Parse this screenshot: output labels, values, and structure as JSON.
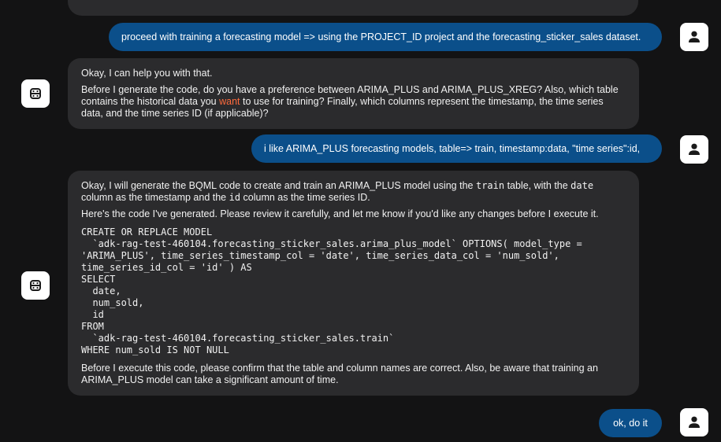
{
  "messages": {
    "user1": "proceed with training a forecasting model => using the PROJECT_ID project and the forecasting_sticker_sales dataset.",
    "bot1": {
      "line1": "Okay, I can help you with that.",
      "para_before": "Before I generate the code, do you have a preference between ARIMA_PLUS and ARIMA_PLUS_XREG? Also, which table contains the historical data you ",
      "para_highlight": "want",
      "para_after": " to use for training? Finally, which columns represent the timestamp, the time series data, and the time series ID (if applicable)?"
    },
    "user2": "i like ARIMA_PLUS forecasting models, table=> train, timestamp:data, \"time series\":id,",
    "bot2": {
      "p1_a": "Okay, I will generate the BQML code to create and train an ARIMA_PLUS model using the ",
      "p1_code1": "train",
      "p1_b": " table, with the ",
      "p1_code2": "date",
      "p1_c": " column as the timestamp and the ",
      "p1_code3": "id",
      "p1_d": " column as the time series ID.",
      "p2": "Here's the code I've generated. Please review it carefully, and let me know if you'd like any changes before I execute it.",
      "code": "CREATE OR REPLACE MODEL\n  `adk-rag-test-460104.forecasting_sticker_sales.arima_plus_model` OPTIONS( model_type =\n'ARIMA_PLUS', time_series_timestamp_col = 'date', time_series_data_col = 'num_sold',\ntime_series_id_col = 'id' ) AS\nSELECT\n  date,\n  num_sold,\n  id\nFROM\n  `adk-rag-test-460104.forecasting_sticker_sales.train`\nWHERE num_sold IS NOT NULL",
      "p3": "Before I execute this code, please confirm that the table and column names are correct. Also, be aware that training an ARIMA_PLUS model can take a significant amount of time."
    },
    "user3": "ok, do it"
  },
  "icons": {
    "user": "user-person-icon",
    "bot": "robot-icon"
  },
  "colors": {
    "background": "#131314",
    "user_bubble": "#0b4f8a",
    "bot_bubble": "#2b2b2d",
    "highlight": "#ff6b3d"
  }
}
